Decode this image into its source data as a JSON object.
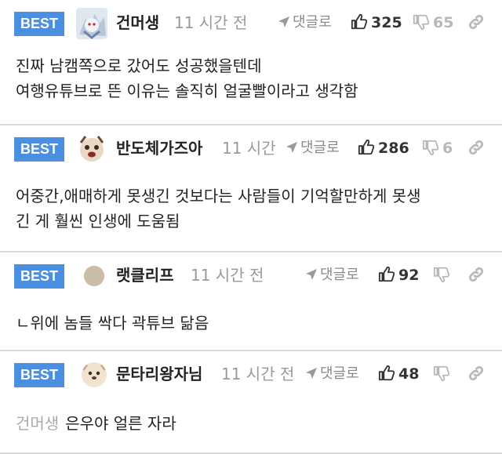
{
  "colors": {
    "best_badge": "#4a8fe0",
    "divider": "#d9d9d9",
    "muted": "#9a9a9a"
  },
  "comments": [
    {
      "badge": "BEST",
      "nickname": "건머생",
      "time": "11 시간 전",
      "reply_label": "댓글로",
      "likes": "325",
      "dislikes": "65",
      "lines": [
        "진짜 남캠쪽으로 갔어도 성공했을텐데",
        "여행유튜브로 뜬 이유는 솔직히 얼굴빨이라고 생각함"
      ]
    },
    {
      "badge": "BEST",
      "nickname": "반도체가즈아",
      "time": "11 시간",
      "reply_label": "댓글로",
      "likes": "286",
      "dislikes": "6",
      "lines": [
        "어중간,애매하게 못생긴 것보다는 사람들이 기억할만하게 못생",
        "긴 게 훨씬 인생에 도움됨"
      ]
    },
    {
      "badge": "BEST",
      "nickname": "랫클리프",
      "time": "11 시간 전",
      "reply_label": "댓글로",
      "likes": "92",
      "lines": [
        "ㄴ위에 놈들 싹다 곽튜브 닮음"
      ]
    },
    {
      "badge": "BEST",
      "nickname": "문타리왕자님",
      "time": "11 시간 전",
      "reply_label": "댓글로",
      "likes": "48",
      "reply_to": "건머생",
      "lines": [
        "은우야 얼른 자라"
      ]
    }
  ]
}
